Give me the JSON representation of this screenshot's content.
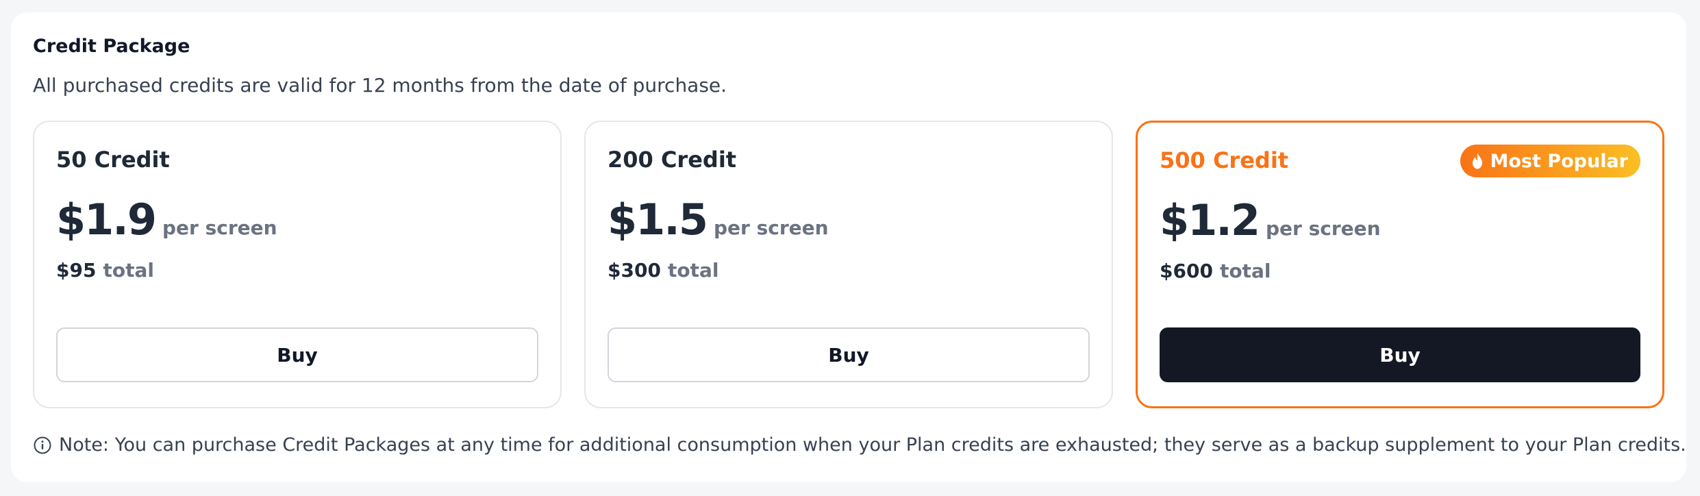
{
  "section": {
    "title": "Credit Package",
    "subtitle": "All purchased credits are valid for 12 months from the date of purchase."
  },
  "packages": [
    {
      "name": "50 Credit",
      "price": "$1.9",
      "per_unit": "per screen",
      "total_amount": "$95",
      "total_label": "total",
      "button_label": "Buy",
      "highlighted": false
    },
    {
      "name": "200 Credit",
      "price": "$1.5",
      "per_unit": "per screen",
      "total_amount": "$300",
      "total_label": "total",
      "button_label": "Buy",
      "highlighted": false
    },
    {
      "name": "500 Credit",
      "price": "$1.2",
      "per_unit": "per screen",
      "total_amount": "$600",
      "total_label": "total",
      "button_label": "Buy",
      "highlighted": true,
      "badge": {
        "label": "Most Popular",
        "icon": "flame-icon"
      }
    }
  ],
  "note": {
    "icon": "info-icon",
    "text": "Note: You can purchase Credit Packages at any time for additional consumption when your Plan credits are exhausted; they serve as a backup supplement to your Plan credits."
  },
  "colors": {
    "accent": "#f97316",
    "accent_gradient_end": "#fbbf24",
    "primary_button": "#141824",
    "text_dark": "#1f2937",
    "text_muted": "#6b7280",
    "border": "#e5e7eb"
  }
}
